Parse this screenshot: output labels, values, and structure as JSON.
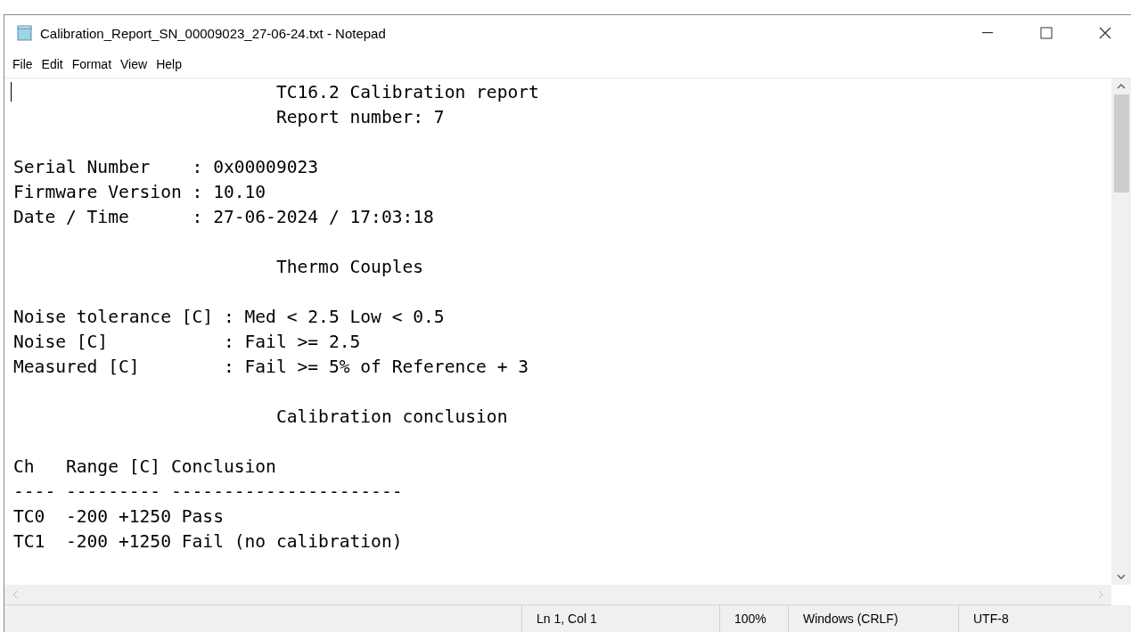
{
  "window": {
    "title": "Calibration_Report_SN_00009023_27-06-24.txt - Notepad"
  },
  "menu": [
    "File",
    "Edit",
    "Format",
    "View",
    "Help"
  ],
  "document": {
    "sections": [
      [
        "                         TC16.2 Calibration report",
        "                         Report number: 7"
      ],
      [
        "Serial Number    : 0x00009023",
        "Firmware Version : 10.10",
        "Date / Time      : 27-06-2024 / 17:03:18"
      ],
      [
        "                         Thermo Couples"
      ],
      [
        "Noise tolerance [C] : Med < 2.5 Low < 0.5",
        "Noise [C]           : Fail >= 2.5",
        "Measured [C]        : Fail >= 5% of Reference + 3"
      ],
      [
        "                         Calibration conclusion"
      ],
      [
        "Ch   Range [C] Conclusion",
        "---- --------- ----------------------",
        "TC0  -200 +1250 Pass",
        "TC1  -200 +1250 Fail (no calibration)"
      ]
    ]
  },
  "status_bar": [
    "Ln 1, Col 1",
    "100%",
    "Windows (CRLF)",
    "UTF-8"
  ]
}
